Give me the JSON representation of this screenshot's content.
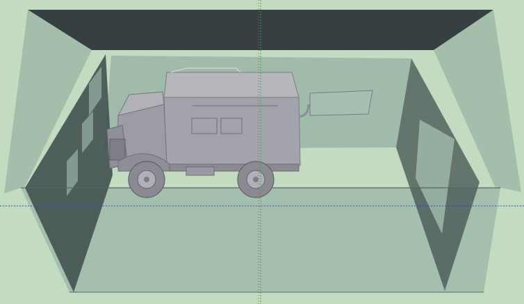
{
  "viewport": {
    "background_color": "#c3dbc0",
    "axis_colors": {
      "red": "#d24b3c",
      "green": "#39a84c",
      "blue": "#2c3fd2"
    },
    "scene_objects": [
      "garage-box",
      "truck"
    ]
  }
}
